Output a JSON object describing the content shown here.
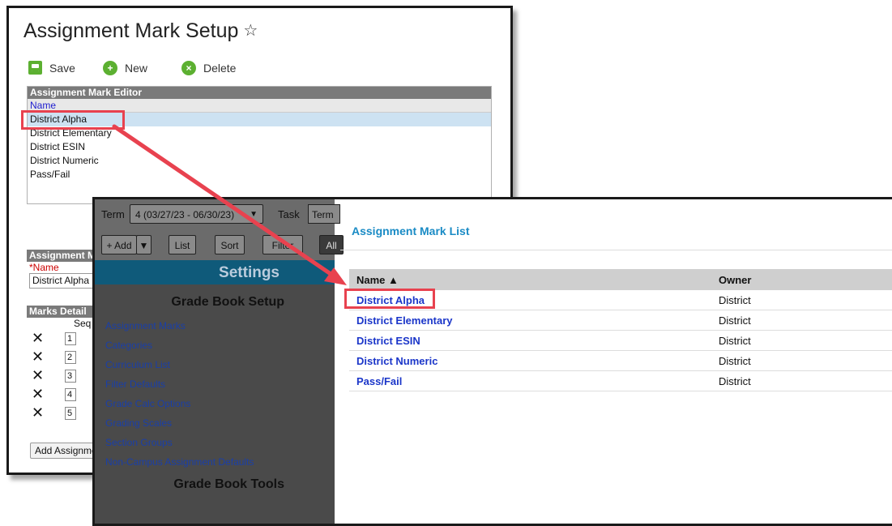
{
  "setup": {
    "title": "Assignment Mark Setup",
    "star_glyph": "☆",
    "toolbar": {
      "save": "Save",
      "new": "New",
      "delete": "Delete"
    },
    "editor_header": "Assignment Mark Editor",
    "column_name": "Name",
    "items": [
      "District Alpha",
      "District Elementary",
      "District ESIN",
      "District Numeric",
      "Pass/Fail"
    ],
    "detail_header": "Assignment Mark Detail",
    "name_label": "*Name",
    "name_value": "District Alpha",
    "marks_header": "Marks Detail",
    "seq_label": "Seq",
    "marks": [
      "1",
      "2",
      "3",
      "4",
      "5"
    ],
    "add_button": "Add Assignment Mark"
  },
  "gradebook": {
    "term_label": "Term",
    "term_value": "4 (03/27/23 - 06/30/23)",
    "task_label": "Task",
    "task_value": "Term",
    "buttons": {
      "add": "+ Add",
      "list": "List",
      "sort": "Sort",
      "filter": "Filter",
      "all": "All"
    },
    "settings_title": "Settings",
    "setup_title": "Grade Book Setup",
    "nav": [
      "Assignment Marks",
      "Categories",
      "Curriculum List",
      "Filter Defaults",
      "Grade Calc Options",
      "Grading Scales",
      "Section Groups",
      "Non-Campus Assignment Defaults"
    ],
    "tools_title": "Grade Book Tools",
    "list_title": "Assignment Mark List",
    "columns": {
      "name": "Name ▲",
      "owner": "Owner"
    },
    "rows": [
      {
        "name": "District Alpha",
        "owner": "District"
      },
      {
        "name": "District Elementary",
        "owner": "District"
      },
      {
        "name": "District ESIN",
        "owner": "District"
      },
      {
        "name": "District Numeric",
        "owner": "District"
      },
      {
        "name": "Pass/Fail",
        "owner": "District"
      }
    ]
  },
  "colors": {
    "highlight": "#e8424f",
    "accent": "#1a8bc5",
    "toolbar_green": "#5cb031"
  }
}
